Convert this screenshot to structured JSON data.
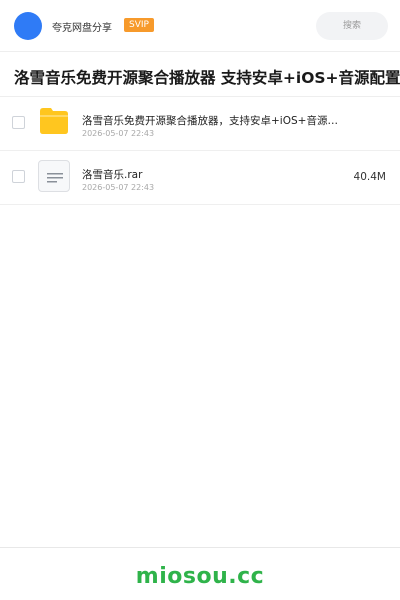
{
  "header": {
    "brand": "夸克网盘分享",
    "badge": "SVIP",
    "search_label": "搜索"
  },
  "share": {
    "title": "洛雪音乐免费开源聚合播放器 支持安卓+iOS+音源配置教程"
  },
  "files": [
    {
      "name": "洛雪音乐免费开源聚合播放器，支持安卓+iOS+音源配置教程",
      "date": "2026-05-07 22:43",
      "size": "",
      "icon": "folder-icon"
    },
    {
      "name": "洛雪音乐.rar",
      "date": "2026-05-07 22:43",
      "size": "40.4M",
      "icon": "document-icon"
    }
  ],
  "footer": {
    "brand": "miosou.cc"
  },
  "colors": {
    "avatar": "#2f7bf6",
    "badge": "#f79a2b",
    "folder": "#ffc61f",
    "footer_brand": "#2fb34a"
  }
}
